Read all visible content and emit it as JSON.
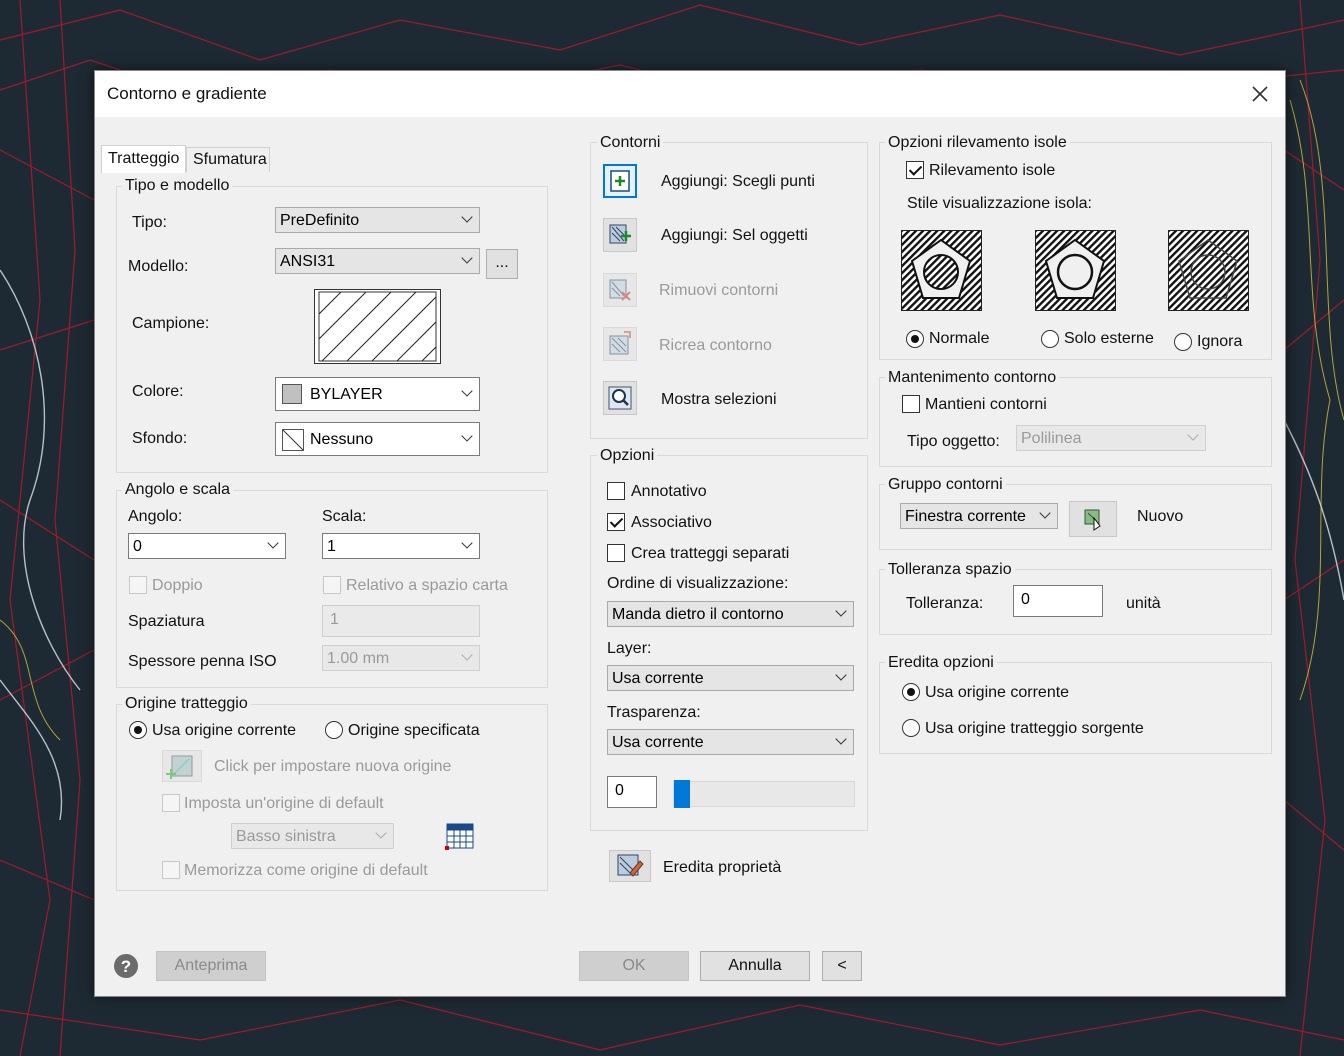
{
  "dialog": {
    "title": "Contorno e gradiente"
  },
  "tabs": [
    {
      "label": "Tratteggio"
    },
    {
      "label": "Sfumatura"
    }
  ],
  "tipo_modello": {
    "group_label": "Tipo e modello",
    "tipo_label": "Tipo:",
    "tipo_value": "PreDefinito",
    "modello_label": "Modello:",
    "modello_value": "ANSI31",
    "browse_label": "...",
    "campione_label": "Campione:",
    "colore_label": "Colore:",
    "colore_value": "BYLAYER",
    "sfondo_label": "Sfondo:",
    "sfondo_value": "Nessuno"
  },
  "angolo_scala": {
    "group_label": "Angolo e scala",
    "angolo_label": "Angolo:",
    "angolo_value": "0",
    "scala_label": "Scala:",
    "scala_value": "1",
    "doppio_label": "Doppio",
    "relativo_label": "Relativo a spazio carta",
    "spaziatura_label": "Spaziatura",
    "spaziatura_value": "1",
    "spessore_label": "Spessore penna ISO",
    "spessore_value": "1.00 mm"
  },
  "origine": {
    "group_label": "Origine tratteggio",
    "usa_corrente_label": "Usa origine corrente",
    "specificata_label": "Origine specificata",
    "click_label": "Click per impostare nuova origine",
    "default_label": "Imposta un'origine di default",
    "posizione_value": "Basso sinistra",
    "memorizza_label": "Memorizza come origine di default"
  },
  "contorni": {
    "group_label": "Contorni",
    "scegli_punti_label": "Aggiungi: Scegli punti",
    "sel_oggetti_label": "Aggiungi: Sel oggetti",
    "rimuovi_label": "Rimuovi contorni",
    "ricrea_label": "Ricrea contorno",
    "mostra_label": "Mostra selezioni"
  },
  "opzioni": {
    "group_label": "Opzioni",
    "annotativo_label": "Annotativo",
    "associativo_label": "Associativo",
    "separati_label": "Crea tratteggi separati",
    "ordine_label": "Ordine di visualizzazione:",
    "ordine_value": "Manda dietro il contorno",
    "layer_label": "Layer:",
    "layer_value": "Usa corrente",
    "trasparenza_label": "Trasparenza:",
    "trasparenza_value": "Usa corrente",
    "trasparenza_amount": "0"
  },
  "eredita_label": "Eredita proprietà",
  "isole": {
    "group_label": "Opzioni rilevamento isole",
    "rilevamento_label": "Rilevamento isole",
    "stile_label": "Stile visualizzazione isola:",
    "normale_label": "Normale",
    "esterne_label": "Solo esterne",
    "ignora_label": "Ignora"
  },
  "mantenimento": {
    "group_label": "Mantenimento contorno",
    "mantieni_label": "Mantieni contorni",
    "tipo_label": "Tipo oggetto:",
    "tipo_value": "Polilinea"
  },
  "gruppo": {
    "group_label": "Gruppo contorni",
    "value": "Finestra corrente",
    "nuovo_label": "Nuovo"
  },
  "tolleranza": {
    "group_label": "Tolleranza spazio",
    "label": "Tolleranza:",
    "value": "0",
    "unit": "unità"
  },
  "eredita_opzioni": {
    "group_label": "Eredita opzioni",
    "corrente_label": "Usa origine corrente",
    "sorgente_label": "Usa origine tratteggio sorgente"
  },
  "footer": {
    "anteprima_label": "Anteprima",
    "ok_label": "OK",
    "annulla_label": "Annulla",
    "collapse_label": "<"
  },
  "colors": {
    "accent": "#0078d7",
    "map_red": "#b0182a",
    "map_yellow": "#d8c23a",
    "background": "#1e2a33"
  }
}
